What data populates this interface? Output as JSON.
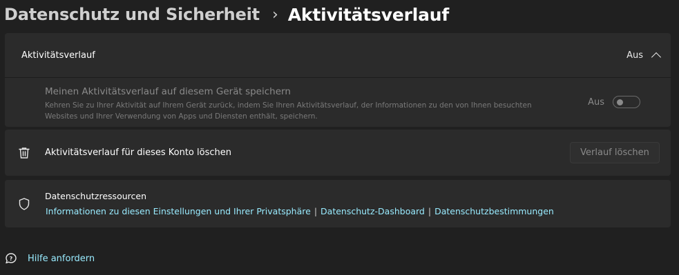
{
  "breadcrumb": {
    "parent": "Datenschutz und Sicherheit",
    "separator": "›",
    "current": "Aktivitätsverlauf"
  },
  "activity_card": {
    "title": "Aktivitätsverlauf",
    "state": "Aus",
    "setting": {
      "title": "Meinen Aktivitätsverlauf auf diesem Gerät speichern",
      "description": "Kehren Sie zu Ihrer Aktivität auf Ihrem Gerät zurück, indem Sie Ihren Aktivitätsverlauf, der Informationen zu den von Ihnen besuchten Websites und Ihrer Verwendung von Apps und Diensten enthält, speichern.",
      "state": "Aus",
      "enabled": false
    }
  },
  "delete_card": {
    "label": "Aktivitätsverlauf für dieses Konto löschen",
    "button": "Verlauf löschen"
  },
  "privacy_card": {
    "title": "Datenschutzressourcen",
    "links": [
      "Informationen zu diesen Einstellungen und Ihrer Privatsphäre",
      "Datenschutz-Dashboard",
      "Datenschutzbestimmungen"
    ],
    "separator": "|"
  },
  "help": {
    "label": "Hilfe anfordern"
  },
  "colors": {
    "background": "#202020",
    "card": "#2b2b2b",
    "link": "#99ebff"
  }
}
